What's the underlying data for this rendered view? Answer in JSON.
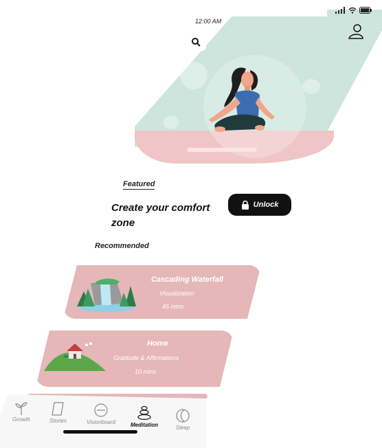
{
  "status": {
    "time": "12:00 AM"
  },
  "header": {
    "search_icon": "search-icon",
    "profile_icon": "user-icon"
  },
  "featured": {
    "label": "Featured",
    "title": "Create your comfort zone",
    "unlock_label": "Unlock",
    "unlock_icon": "lock-icon"
  },
  "recommended": {
    "label": "Recommended",
    "items": [
      {
        "title": "Cascading Waterfall",
        "category": "Visualization",
        "duration": "45 mins"
      },
      {
        "title": "Home",
        "category": "Gratitude & Affirmations",
        "duration": "10 mins"
      }
    ]
  },
  "tabs": [
    {
      "label": "Growth",
      "icon": "sprout-icon"
    },
    {
      "label": "Stories",
      "icon": "book-icon"
    },
    {
      "label": "Visionboard",
      "icon": "circle-icon"
    },
    {
      "label": "Meditation",
      "icon": "stones-icon",
      "active": true
    },
    {
      "label": "Sleep",
      "icon": "moon-icon"
    }
  ],
  "colors": {
    "hero_bg": "#cde5dd",
    "floor": "#efc5c5",
    "card": "#e5b7b8",
    "accent_dark": "#111111",
    "shirt": "#3b6db0",
    "pants": "#1f3b3b"
  }
}
